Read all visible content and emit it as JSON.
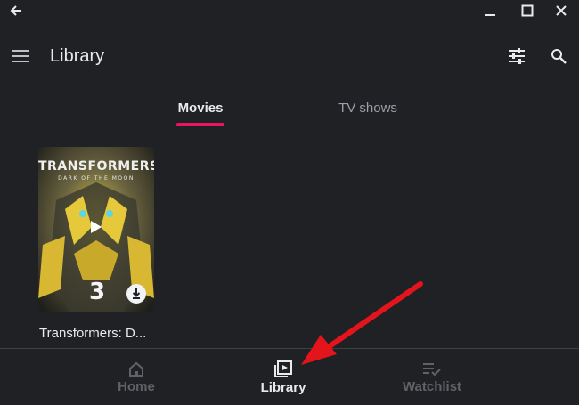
{
  "app": {
    "title": "Library"
  },
  "tabs": [
    {
      "label": "Movies",
      "selected": true
    },
    {
      "label": "TV shows",
      "selected": false
    }
  ],
  "library": {
    "items": [
      {
        "label": "Transformers: D...",
        "poster": {
          "title": "TRANSFORMERS",
          "subtitle": "DARK OF THE MOON",
          "number": "3"
        }
      }
    ]
  },
  "bottom_nav": [
    {
      "label": "Home",
      "icon": "home-icon",
      "selected": false
    },
    {
      "label": "Library",
      "icon": "library-icon",
      "selected": true
    },
    {
      "label": "Watchlist",
      "icon": "watchlist-icon",
      "selected": false
    }
  ],
  "colors": {
    "background": "#202124",
    "accent": "#e8175d",
    "annotation_arrow": "#e3141b"
  }
}
